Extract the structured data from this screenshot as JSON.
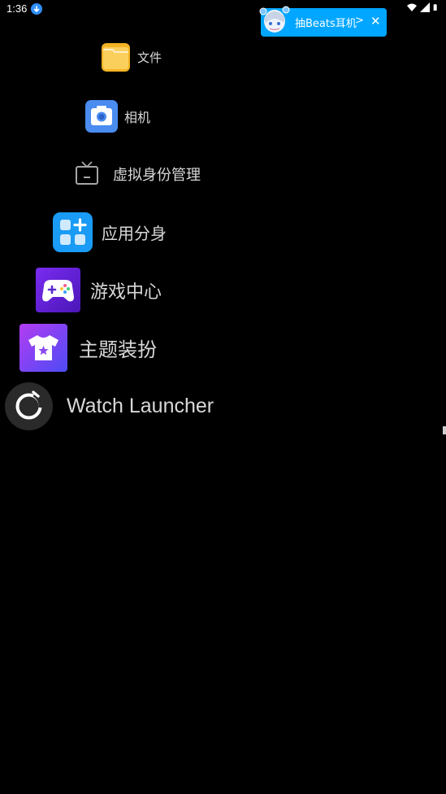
{
  "status": {
    "time": "1:36"
  },
  "ad_banner": {
    "text": "抽Beats耳机",
    "chevron": ">",
    "close": "✕"
  },
  "menu": {
    "items": [
      {
        "label": "文件",
        "icon": "folder-icon"
      },
      {
        "label": "相机",
        "icon": "camera-icon"
      },
      {
        "label": "虚拟身份管理",
        "icon": "tv-icon"
      },
      {
        "label": "应用分身",
        "icon": "app-clone-icon"
      },
      {
        "label": "游戏中心",
        "icon": "game-controller-icon"
      },
      {
        "label": "主题装扮",
        "icon": "theme-shirt-icon"
      },
      {
        "label": "Watch Launcher",
        "icon": "watch-launcher-icon"
      }
    ]
  }
}
